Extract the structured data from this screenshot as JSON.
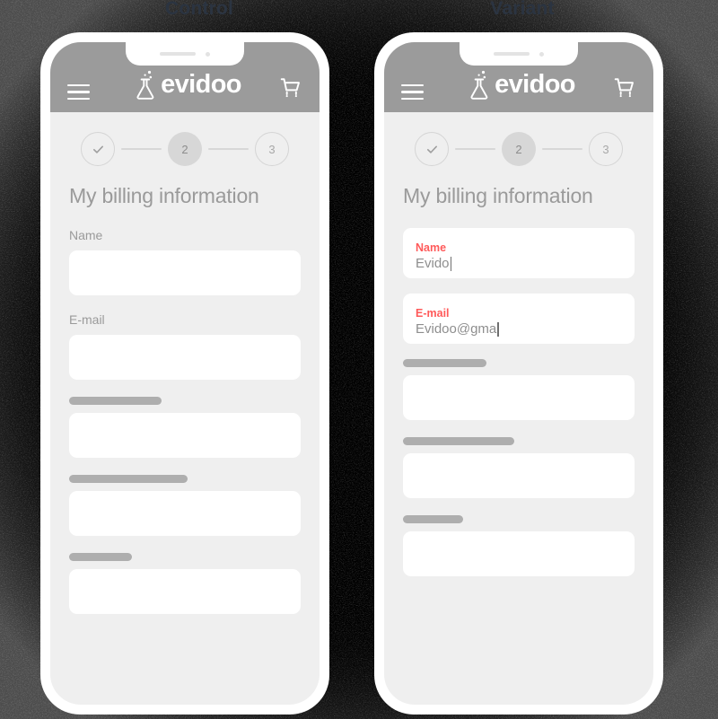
{
  "comparison": {
    "control_label": "Control",
    "variant_label": "Variant"
  },
  "colors": {
    "backdrop": "#000000",
    "phone_frame": "#ffffff",
    "screen_bg": "#efefef",
    "app_header": "#9b9b9b",
    "accent_red": "#ff5a5a",
    "label_gray": "#9a9a9a",
    "placeholder_bar": "#aeaeae",
    "condition_label": "#2b3441"
  },
  "app": {
    "brand_name": "evidoo",
    "menu_icon": "hamburger-menu-icon",
    "logo_icon": "flask-icon",
    "cart_icon": "shopping-cart-icon"
  },
  "stepper": {
    "steps": [
      {
        "id": "step-1",
        "label": "✓",
        "state": "done"
      },
      {
        "id": "step-2",
        "label": "2",
        "state": "active"
      },
      {
        "id": "step-3",
        "label": "3",
        "state": "pending"
      }
    ]
  },
  "page": {
    "title": "My billing information"
  },
  "control": {
    "fields": [
      {
        "label": "Name",
        "type": "labeled",
        "value": ""
      },
      {
        "label": "E-mail",
        "type": "labeled",
        "value": ""
      },
      {
        "label": "",
        "type": "skeleton",
        "bar_width": "40%",
        "value": ""
      },
      {
        "label": "",
        "type": "skeleton",
        "bar_width": "51%",
        "value": ""
      },
      {
        "label": "",
        "type": "skeleton",
        "bar_width": "27%",
        "value": ""
      }
    ]
  },
  "variant": {
    "fields": [
      {
        "label": "Name",
        "type": "floating",
        "value": "Evido"
      },
      {
        "label": "E-mail",
        "type": "floating",
        "value": "Evidoo@gma"
      },
      {
        "label": "",
        "type": "skeleton",
        "bar_width": "36%",
        "value": ""
      },
      {
        "label": "",
        "type": "skeleton",
        "bar_width": "48%",
        "value": ""
      },
      {
        "label": "",
        "type": "skeleton",
        "bar_width": "26%",
        "value": ""
      }
    ]
  }
}
